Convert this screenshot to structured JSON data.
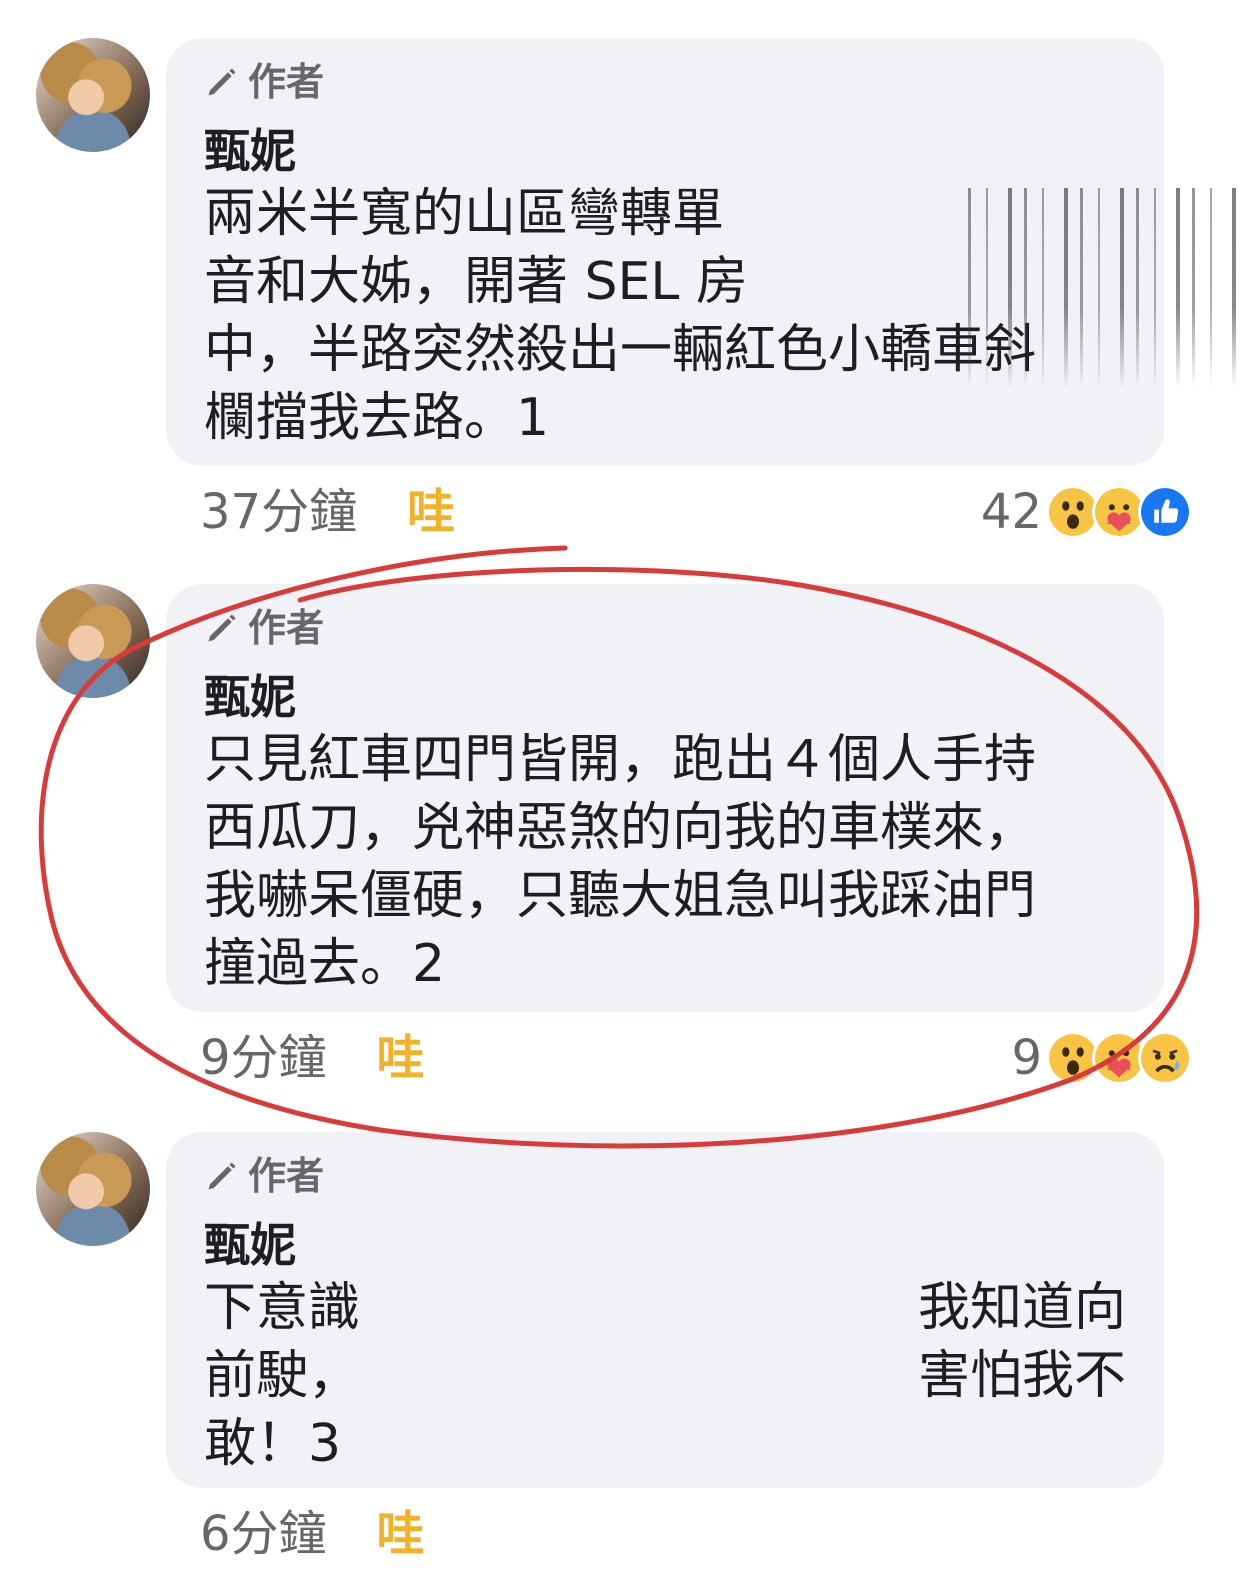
{
  "comments": [
    {
      "badge": "作者",
      "author": "甄妮",
      "text": "兩米半寬的山區彎轉單\n音和大姊，開著 SEL 房\n中，半路突然殺出一輛紅色小轎車斜\n欄擋我去路。1",
      "time": "37分鐘",
      "reaction_label": "哇",
      "reaction_count": "42",
      "reaction_icons": [
        "wow-icon",
        "care-icon",
        "like-icon"
      ]
    },
    {
      "badge": "作者",
      "author": "甄妮",
      "text": "只見紅車四門皆開，跑出４個人手持\n西瓜刀，兇神惡煞的向我的車樸來，\n我嚇呆僵硬，只聽大姐急叫我踩油門\n撞過去。2",
      "time": "9分鐘",
      "reaction_label": "哇",
      "reaction_count": "9",
      "reaction_icons": [
        "wow-icon",
        "care-icon",
        "sad-icon"
      ]
    },
    {
      "badge": "作者",
      "author": "甄妮",
      "text_left": "下意識\n前駛，\n敢！3",
      "text_right": "我知道向\n害怕我不",
      "time": "6分鐘",
      "reaction_label": "哇"
    }
  ],
  "colors": {
    "bubble": "#f0f2f5",
    "wow_label": "#f2b129",
    "meta_text": "#65676b",
    "annotation": "#d93a3a",
    "like_blue": "#1877f2"
  }
}
